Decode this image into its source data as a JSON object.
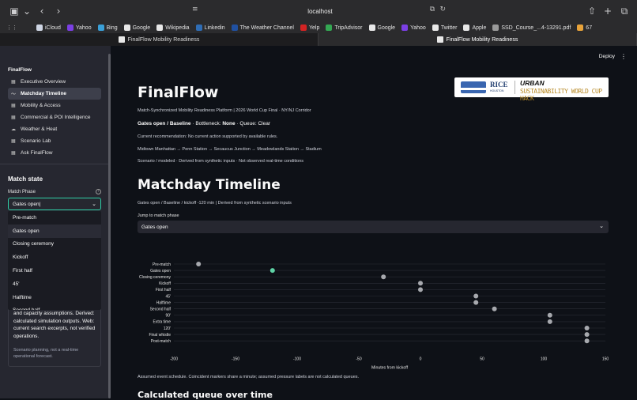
{
  "browser": {
    "url": "localhost",
    "bookmarks": [
      {
        "label": "iCloud",
        "color": "#cfd6e4"
      },
      {
        "label": "Yahoo",
        "color": "#7b3fe4"
      },
      {
        "label": "Bing",
        "color": "#3aa0d8"
      },
      {
        "label": "Google",
        "color": "#e8e8e8"
      },
      {
        "label": "Wikipedia",
        "color": "#e8e8e8"
      },
      {
        "label": "Linkedin",
        "color": "#2f6db5"
      },
      {
        "label": "The Weather Channel",
        "color": "#2050a0"
      },
      {
        "label": "Yelp",
        "color": "#d32323"
      },
      {
        "label": "TripAdvisor",
        "color": "#34a853"
      },
      {
        "label": "Google",
        "color": "#e8e8e8"
      },
      {
        "label": "Yahoo",
        "color": "#7b3fe4"
      },
      {
        "label": "Twitter",
        "color": "#e8e8e8"
      },
      {
        "label": "Apple",
        "color": "#e8e8e8"
      },
      {
        "label": "SSD_Course_...4-13291.pdf",
        "color": "#9a9a9a"
      },
      {
        "label": "67",
        "color": "#e8a33a"
      }
    ],
    "tabs": [
      {
        "label": "FinalFlow Mobility Readiness",
        "active": false
      },
      {
        "label": "FinalFlow Mobility Readiness",
        "active": true
      }
    ]
  },
  "sidebar": {
    "title": "FinalFlow",
    "nav": [
      {
        "label": "Executive Overview",
        "icon": "grid-icon",
        "glyph": "▦",
        "active": false
      },
      {
        "label": "Matchday Timeline",
        "icon": "trend-icon",
        "glyph": "〜",
        "active": true
      },
      {
        "label": "Mobility & Access",
        "icon": "grid-icon",
        "glyph": "▦",
        "active": false
      },
      {
        "label": "Commercial & POI Intelligence",
        "icon": "grid-icon",
        "glyph": "▦",
        "active": false
      },
      {
        "label": "Weather & Heat",
        "icon": "cloud-icon",
        "glyph": "☁",
        "active": false
      },
      {
        "label": "Scenario Lab",
        "icon": "grid-icon",
        "glyph": "▦",
        "active": false
      },
      {
        "label": "Ask FinalFlow",
        "icon": "grid-icon",
        "glyph": "▦",
        "active": false
      }
    ],
    "match_state_title": "Match state",
    "phase_label": "Match Phase",
    "phase_value": "Gates open",
    "phase_options": [
      "Pre-match",
      "Gates open",
      "Closing ceremony",
      "Kickoff",
      "First half",
      "45'",
      "Halftime",
      "Second half"
    ],
    "selected_option": "Gates open",
    "info_text": "and capacity assumptions. Derived: calculated simulation outputs. Web: current search excerpts, not verified operations.",
    "info_note": "Scenario planning, not a real-time operational forecast."
  },
  "header": {
    "deploy": "Deploy",
    "menu_glyph": "⋮"
  },
  "main": {
    "title": "FinalFlow",
    "platform_line": "Match-Synchronized Mobility Readiness Platform | 2026 World Cup Final · NY/NJ Corridor",
    "status": {
      "phase": "Gates open / Baseline",
      "sep1": " · Bottleneck: ",
      "bottleneck": "None",
      "sep2": " · Queue: Clear"
    },
    "recommendation": "Current recommendation: No current action supported by available rules.",
    "route": "Midtown Manhattan → Penn Station → Secaucus Junction → Meadowlands Station → Stadium",
    "scenario_note": "Scenario / modeled · Derived from synthetic inputs · Not observed real-time conditions",
    "section_title": "Matchday Timeline",
    "section_sub": "Gates open / Baseline / kickoff -120 min | Derived from synthetic scenario inputs",
    "jump_label": "Jump to match phase",
    "jump_value": "Gates open",
    "caption": "Assumed event schedule. Coincident markers share a minute; assumed pressure labels are not calculated queues.",
    "next_title": "Calculated queue over time"
  },
  "logo": {
    "name": "RICE",
    "small": "HOUSTON",
    "title1": "URBAN",
    "title2": "SUSTAINABILITY WORLD CUP HACK"
  },
  "chart_data": {
    "type": "scatter",
    "xlabel": "Minutes from kickoff",
    "xlim": [
      -200,
      150
    ],
    "xticks": [
      -200,
      -150,
      -100,
      -50,
      0,
      50,
      100,
      150
    ],
    "categories": [
      "Pre-match",
      "Gates open",
      "Closing ceremony",
      "Kickoff",
      "First half",
      "45'",
      "Halftime",
      "Second half",
      "90'",
      "Extra time",
      "120'",
      "Final whistle",
      "Post-match"
    ],
    "values": [
      -180,
      -120,
      -30,
      0,
      0,
      45,
      45,
      60,
      105,
      105,
      135,
      135,
      135
    ],
    "highlight_index": 1,
    "highlight_color": "#5fd3a6",
    "point_color": "#a7a9ae"
  }
}
